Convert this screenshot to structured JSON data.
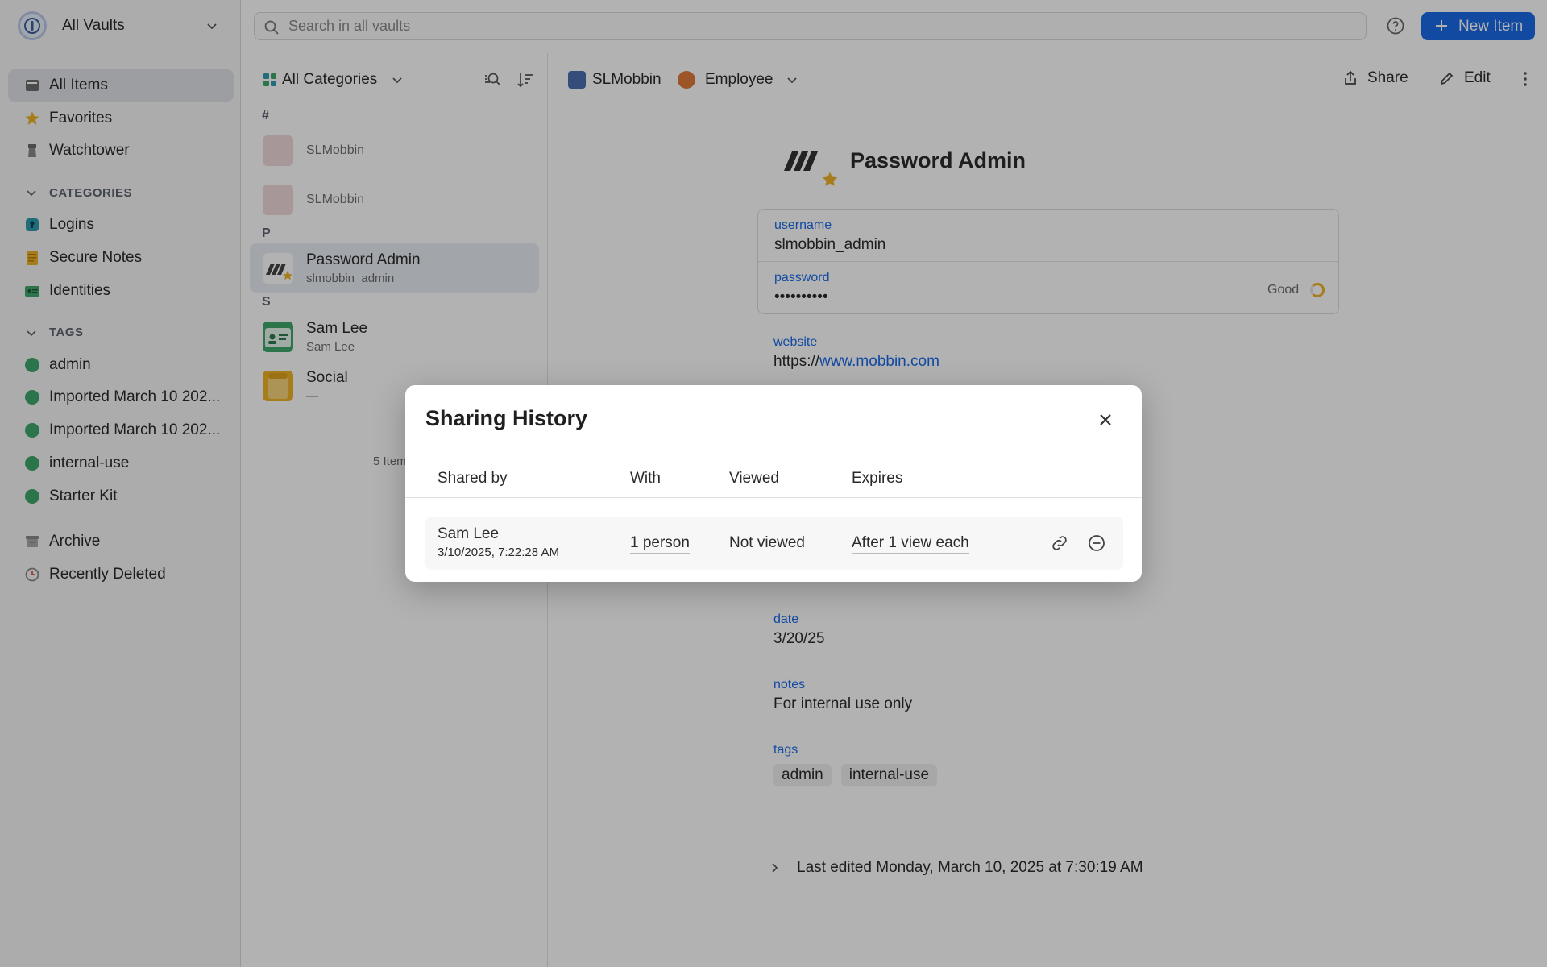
{
  "sidebar": {
    "vault_name": "All Vaults",
    "nav": [
      {
        "label": "All Items"
      },
      {
        "label": "Favorites"
      },
      {
        "label": "Watchtower"
      }
    ],
    "categories_heading": "CATEGORIES",
    "categories": [
      {
        "label": "Logins"
      },
      {
        "label": "Secure Notes"
      },
      {
        "label": "Identities"
      }
    ],
    "tags_heading": "TAGS",
    "tags": [
      {
        "label": "admin"
      },
      {
        "label": "Imported March 10 202..."
      },
      {
        "label": "Imported March 10 202..."
      },
      {
        "label": "internal-use"
      },
      {
        "label": "Starter Kit"
      }
    ],
    "bottom": [
      {
        "label": "Archive"
      },
      {
        "label": "Recently Deleted"
      }
    ]
  },
  "topbar": {
    "search_placeholder": "Search in all vaults",
    "new_item_label": "New Item"
  },
  "list": {
    "category_filter": "All Categories",
    "groups": [
      {
        "letter": "#",
        "items": [
          {
            "title": "SLMobbin",
            "subtitle": ""
          },
          {
            "title": "SLMobbin",
            "subtitle": ""
          }
        ]
      },
      {
        "letter": "P",
        "items": [
          {
            "title": "Password Admin",
            "subtitle": "slmobbin_admin"
          }
        ]
      },
      {
        "letter": "S",
        "items": [
          {
            "title": "Sam Lee",
            "subtitle": "Sam Lee"
          },
          {
            "title": "Social",
            "subtitle": "—"
          }
        ]
      }
    ],
    "count_label": "5 Items"
  },
  "detail": {
    "vault_label": "SLMobbin",
    "employee_label": "Employee",
    "share_label": "Share",
    "edit_label": "Edit",
    "item_title": "Password Admin",
    "username_label": "username",
    "username_value": "slmobbin_admin",
    "password_label": "password",
    "password_value": "••••••••••",
    "password_strength": "Good",
    "website_label": "website",
    "website_prefix": "https://",
    "website_link": "www.mobbin.com",
    "date_label": "date",
    "date_value": "3/20/25",
    "notes_label": "notes",
    "notes_value": "For internal use only",
    "tags_label": "tags",
    "tags": [
      "admin",
      "internal-use"
    ],
    "last_edited": "Last edited Monday, March 10, 2025 at 7:30:19 AM"
  },
  "modal": {
    "title": "Sharing History",
    "columns": [
      "Shared by",
      "With",
      "Viewed",
      "Expires"
    ],
    "rows": [
      {
        "shared_by": "Sam Lee",
        "shared_at": "3/10/2025, 7:22:28 AM",
        "with": "1 person",
        "viewed": "Not viewed",
        "expires": "After 1 view each"
      }
    ]
  },
  "colors": {
    "accent": "#1a6be8",
    "tag_dot": "#3fa86b",
    "overlay": "rgba(0,0,0,0.3)"
  }
}
